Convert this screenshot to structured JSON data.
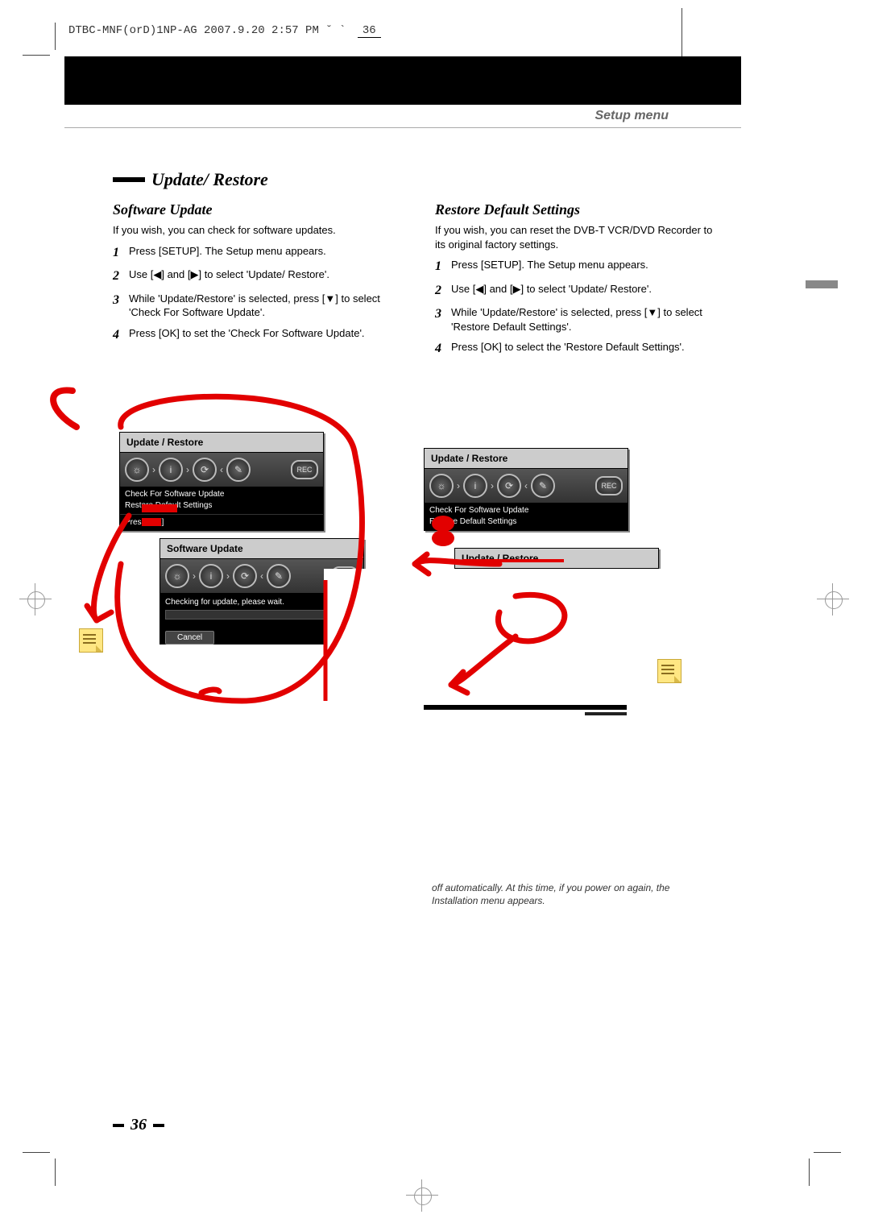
{
  "header_strip": "DTBC-MNF(orD)1NP-AG  2007.9.20 2:57 PM  ˘ ` ",
  "header_page": "36",
  "setup_menu_label": "Setup menu",
  "section_title": "Update/ Restore",
  "page_number": "36",
  "left": {
    "subhead": "Software Update",
    "intro": "If you wish, you can check for software updates.",
    "steps": [
      "Press [SETUP]. The Setup menu appears.",
      "Use [◀] and [▶] to select 'Update/ Restore'.",
      "While 'Update/Restore' is selected, press [▼] to select 'Check For Software Update'.",
      "Press [OK] to set the 'Check For Software Update'."
    ],
    "osd1": {
      "title": "Update / Restore",
      "list_line1": "Check For Software Update",
      "list_line2": "Restore Default Settings",
      "footer": "Press [OK]"
    },
    "osd2": {
      "title": "Software Update",
      "msg": "Checking for update, please wait.",
      "cancel": "Cancel"
    }
  },
  "right": {
    "subhead": "Restore Default Settings",
    "intro": "If you wish, you can reset the DVB-T VCR/DVD Recorder to its original factory settings.",
    "steps": [
      "Press [SETUP]. The Setup menu appears.",
      "Use [◀] and [▶] to select 'Update/ Restore'.",
      "While 'Update/Restore' is selected, press [▼] to select 'Restore Default Settings'.",
      "Press [OK] to select the 'Restore Default Settings'."
    ],
    "osd1": {
      "title": "Update / Restore",
      "list_line1": "Check For Software Update",
      "list_line2": "Restore Default Settings"
    },
    "osd_inner_title": "Update / Restore",
    "footnote": "off automatically. At this time, if you power on again, the Installation menu appears."
  },
  "icons": {
    "rec_label": "REC"
  }
}
